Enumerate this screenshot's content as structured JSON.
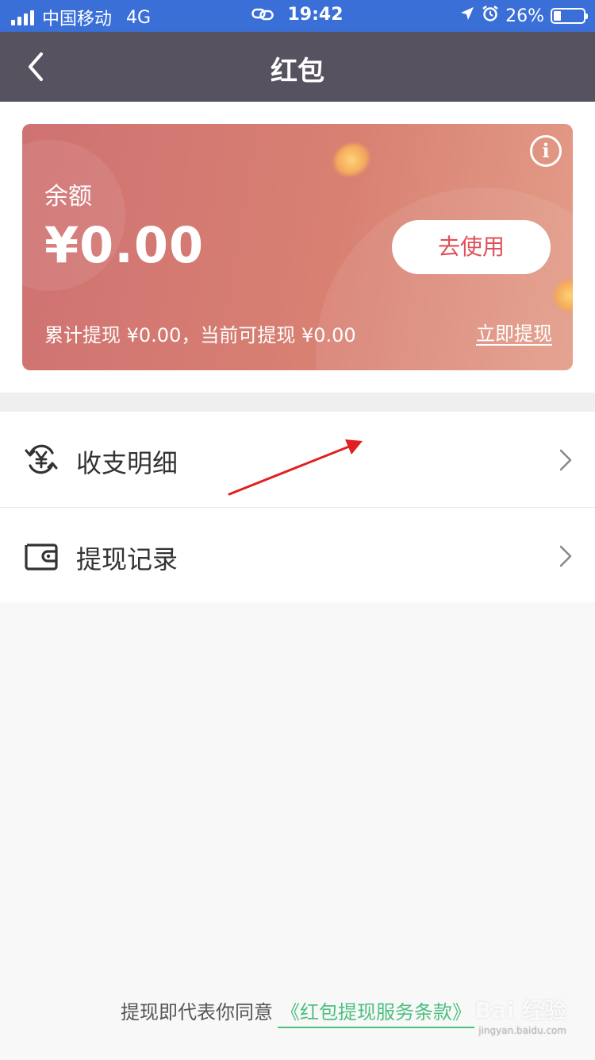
{
  "status_bar": {
    "carrier": "中国移动",
    "network": "4G",
    "time": "19:42",
    "battery": "26%"
  },
  "nav": {
    "title": "红包"
  },
  "card": {
    "balance_label": "余额",
    "balance_amount": "¥0.00",
    "use_button": "去使用",
    "withdraw_info": "累计提现 ¥0.00，当前可提现 ¥0.00",
    "withdraw_now": "立即提现",
    "info_icon": "i"
  },
  "menu": {
    "items": [
      {
        "label": "收支明细",
        "icon": "yen-cycle-icon"
      },
      {
        "label": "提现记录",
        "icon": "wallet-icon"
      }
    ]
  },
  "footer": {
    "text": "提现即代表你同意",
    "terms_link": "《红包提现服务条款》"
  },
  "watermark": {
    "text": "Bai 经验",
    "url": "jingyan.baidu.com"
  },
  "colors": {
    "status_bar": "#3a6fd8",
    "nav_bar": "#57525f",
    "card_start": "#cf7272",
    "card_end": "#e39c88",
    "use_button_text": "#e0505a",
    "terms_link": "#4dbf7f",
    "annotation_arrow": "#e02020"
  }
}
